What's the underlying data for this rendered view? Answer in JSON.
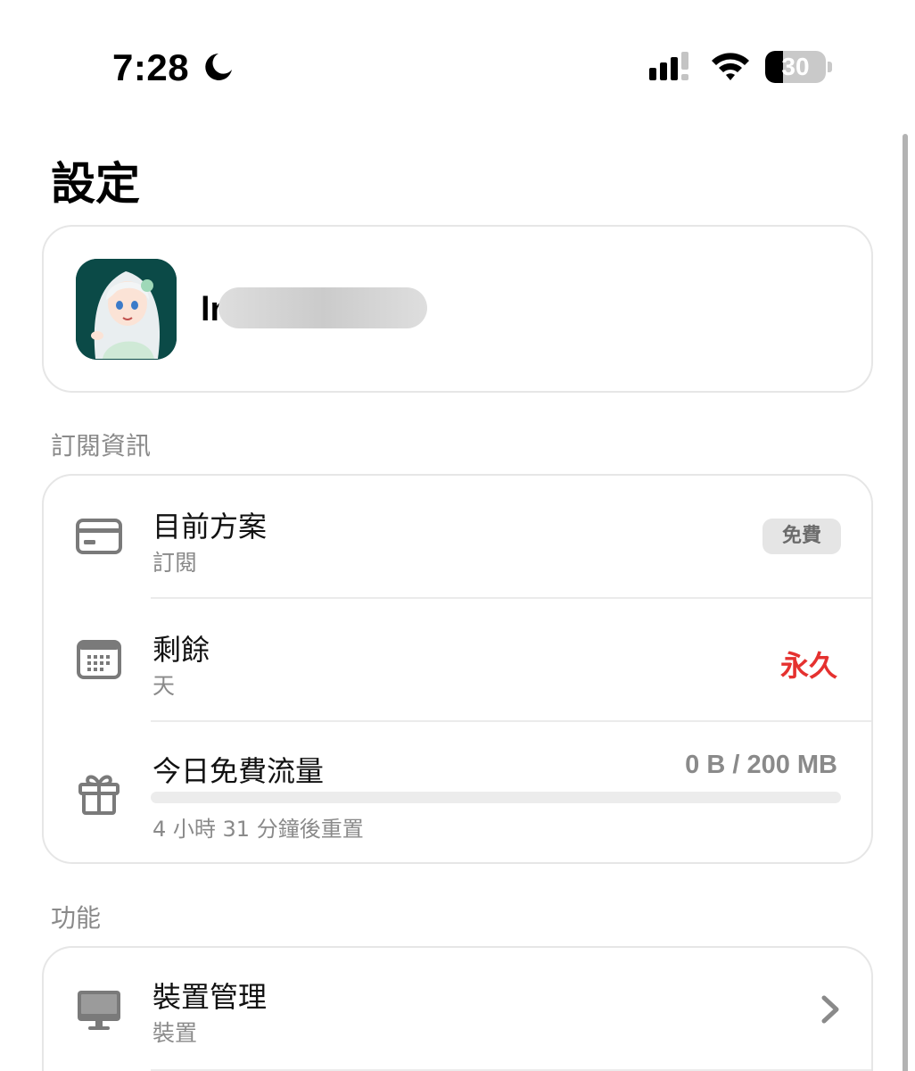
{
  "status_bar": {
    "time": "7:28",
    "battery_level": "30",
    "battery_fraction": 0.3
  },
  "page_title": "設定",
  "profile": {
    "email": "ln                    .com",
    "avatar_icon": "anime-avatar"
  },
  "sections": {
    "subscription": "訂閱資訊",
    "features": "功能"
  },
  "subscription": {
    "plan": {
      "title": "目前方案",
      "subtitle": "訂閱",
      "badge": "免費",
      "icon": "credit-card-icon"
    },
    "remaining": {
      "title": "剩餘",
      "subtitle": "天",
      "value": "永久",
      "value_color": "#e5312f",
      "icon": "calendar-icon"
    },
    "traffic": {
      "title": "今日免費流量",
      "usage": "0 B / 200 MB",
      "used_fraction": 0,
      "reset": "4 小時 31 分鐘後重置",
      "icon": "gift-icon"
    }
  },
  "features": {
    "devices": {
      "title": "裝置管理",
      "subtitle": "裝置",
      "icon": "desktop-icon"
    }
  },
  "colors": {
    "accent_red": "#e5312f",
    "secondary_text": "#8a8a8a",
    "card_border": "#e6e6e6"
  }
}
